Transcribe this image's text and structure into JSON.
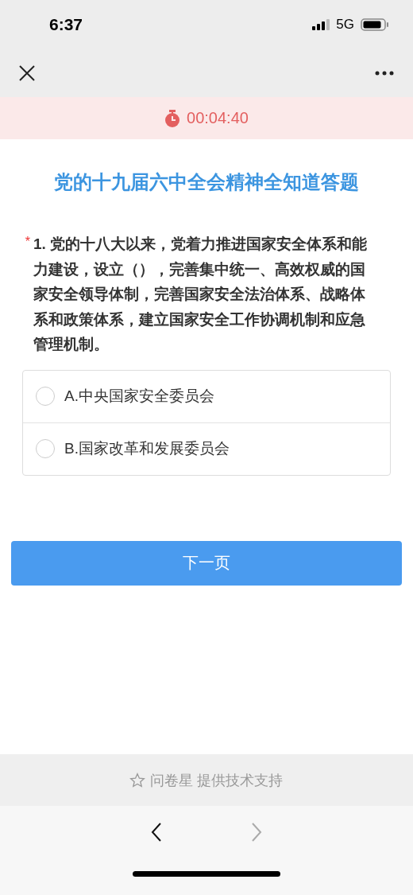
{
  "status_bar": {
    "time": "6:37",
    "network": "5G"
  },
  "timer": {
    "time": "00:04:40"
  },
  "survey": {
    "title": "党的十九届六中全会精神全知道答题",
    "question": {
      "required": true,
      "mark": "*",
      "text": "1. 党的十八大以来，党着力推进国家安全体系和能力建设，设立（），完善集中统一、高效权威的国家安全领导体制，完善国家安全法治体系、战略体系和政策体系，建立国家安全工作协调机制和应急管理机制。",
      "options": [
        {
          "label": "A.中央国家安全委员会",
          "selected": false
        },
        {
          "label": "B.国家改革和发展委员会",
          "selected": false
        }
      ]
    },
    "next_button": "下一页"
  },
  "footer": {
    "text": "问卷星 提供技术支持"
  },
  "browser_toolbar": {
    "back": {
      "disabled": false
    },
    "forward": {
      "disabled": true
    }
  }
}
